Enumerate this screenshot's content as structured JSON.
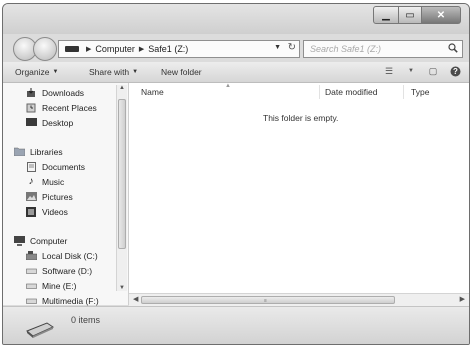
{
  "address": {
    "crumbs": [
      "Computer",
      "Safe1 (Z:)"
    ],
    "refresh_glyph": "↻"
  },
  "search": {
    "placeholder": "Search Safe1 (Z:)"
  },
  "toolbar": {
    "organize": "Organize",
    "share_with": "Share with",
    "new_folder": "New folder"
  },
  "nav": {
    "favorites": [
      {
        "label": "Downloads",
        "icon": "downloads-icon"
      },
      {
        "label": "Recent Places",
        "icon": "recent-places-icon"
      },
      {
        "label": "Desktop",
        "icon": "desktop-icon"
      }
    ],
    "libraries_label": "Libraries",
    "libraries": [
      {
        "label": "Documents",
        "icon": "documents-icon"
      },
      {
        "label": "Music",
        "icon": "music-icon"
      },
      {
        "label": "Pictures",
        "icon": "pictures-icon"
      },
      {
        "label": "Videos",
        "icon": "videos-icon"
      }
    ],
    "computer_label": "Computer",
    "drives": [
      {
        "label": "Local Disk (C:)",
        "icon": "local-disk-icon"
      },
      {
        "label": "Software (D:)",
        "icon": "drive-icon"
      },
      {
        "label": "Mine (E:)",
        "icon": "drive-icon"
      },
      {
        "label": "Multimedia (F:)",
        "icon": "drive-icon"
      }
    ]
  },
  "columns": {
    "name": "Name",
    "date_modified": "Date modified",
    "type": "Type"
  },
  "content": {
    "empty_message": "This folder is empty."
  },
  "status": {
    "item_count": "0 items"
  }
}
